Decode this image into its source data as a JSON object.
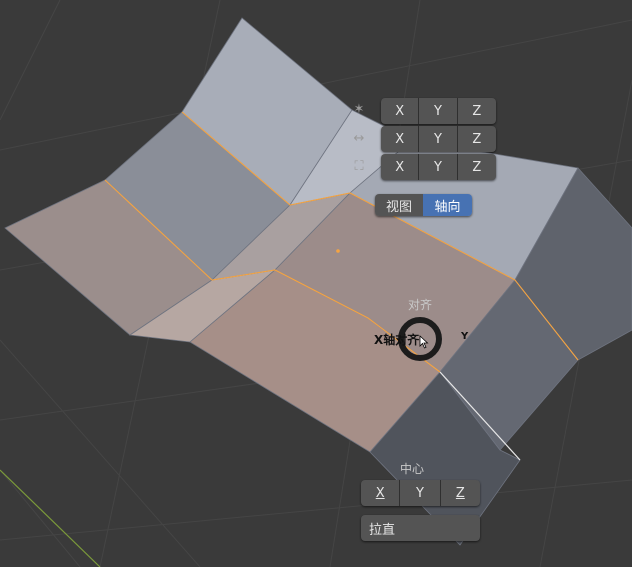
{
  "rows": [
    {
      "icon": "scale-icon",
      "glyph": "✶",
      "buttons": [
        "X",
        "Y",
        "Z"
      ]
    },
    {
      "icon": "move-icon",
      "glyph": "↔",
      "buttons": [
        "X",
        "Y",
        "Z"
      ]
    },
    {
      "icon": "rotate-icon",
      "glyph": "⛶",
      "buttons": [
        "X",
        "Y",
        "Z"
      ]
    }
  ],
  "orientation": {
    "view": "视图",
    "axis": "轴向",
    "active": "axis"
  },
  "align": {
    "label": "对齐",
    "option_left": "X轴对齐",
    "option_right": "Y"
  },
  "center": {
    "label": "中心",
    "buttons": [
      "X",
      "Y",
      "Z"
    ]
  },
  "straighten": "拉直",
  "colors": {
    "accent": "#4772b3",
    "edge_selected": "#f5a442",
    "background": "#3a3a3a"
  }
}
